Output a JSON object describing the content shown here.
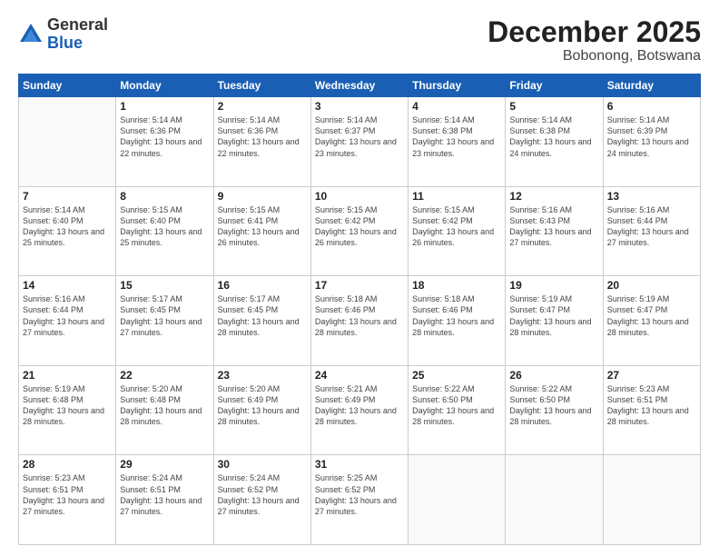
{
  "header": {
    "logo": {
      "general": "General",
      "blue": "Blue"
    },
    "title": "December 2025",
    "subtitle": "Bobonong, Botswana"
  },
  "weekdays": [
    "Sunday",
    "Monday",
    "Tuesday",
    "Wednesday",
    "Thursday",
    "Friday",
    "Saturday"
  ],
  "weeks": [
    [
      {
        "day": "",
        "empty": true
      },
      {
        "day": "1",
        "sunrise": "Sunrise: 5:14 AM",
        "sunset": "Sunset: 6:36 PM",
        "daylight": "Daylight: 13 hours and 22 minutes."
      },
      {
        "day": "2",
        "sunrise": "Sunrise: 5:14 AM",
        "sunset": "Sunset: 6:36 PM",
        "daylight": "Daylight: 13 hours and 22 minutes."
      },
      {
        "day": "3",
        "sunrise": "Sunrise: 5:14 AM",
        "sunset": "Sunset: 6:37 PM",
        "daylight": "Daylight: 13 hours and 23 minutes."
      },
      {
        "day": "4",
        "sunrise": "Sunrise: 5:14 AM",
        "sunset": "Sunset: 6:38 PM",
        "daylight": "Daylight: 13 hours and 23 minutes."
      },
      {
        "day": "5",
        "sunrise": "Sunrise: 5:14 AM",
        "sunset": "Sunset: 6:38 PM",
        "daylight": "Daylight: 13 hours and 24 minutes."
      },
      {
        "day": "6",
        "sunrise": "Sunrise: 5:14 AM",
        "sunset": "Sunset: 6:39 PM",
        "daylight": "Daylight: 13 hours and 24 minutes."
      }
    ],
    [
      {
        "day": "7",
        "sunrise": "Sunrise: 5:14 AM",
        "sunset": "Sunset: 6:40 PM",
        "daylight": "Daylight: 13 hours and 25 minutes."
      },
      {
        "day": "8",
        "sunrise": "Sunrise: 5:15 AM",
        "sunset": "Sunset: 6:40 PM",
        "daylight": "Daylight: 13 hours and 25 minutes."
      },
      {
        "day": "9",
        "sunrise": "Sunrise: 5:15 AM",
        "sunset": "Sunset: 6:41 PM",
        "daylight": "Daylight: 13 hours and 26 minutes."
      },
      {
        "day": "10",
        "sunrise": "Sunrise: 5:15 AM",
        "sunset": "Sunset: 6:42 PM",
        "daylight": "Daylight: 13 hours and 26 minutes."
      },
      {
        "day": "11",
        "sunrise": "Sunrise: 5:15 AM",
        "sunset": "Sunset: 6:42 PM",
        "daylight": "Daylight: 13 hours and 26 minutes."
      },
      {
        "day": "12",
        "sunrise": "Sunrise: 5:16 AM",
        "sunset": "Sunset: 6:43 PM",
        "daylight": "Daylight: 13 hours and 27 minutes."
      },
      {
        "day": "13",
        "sunrise": "Sunrise: 5:16 AM",
        "sunset": "Sunset: 6:44 PM",
        "daylight": "Daylight: 13 hours and 27 minutes."
      }
    ],
    [
      {
        "day": "14",
        "sunrise": "Sunrise: 5:16 AM",
        "sunset": "Sunset: 6:44 PM",
        "daylight": "Daylight: 13 hours and 27 minutes."
      },
      {
        "day": "15",
        "sunrise": "Sunrise: 5:17 AM",
        "sunset": "Sunset: 6:45 PM",
        "daylight": "Daylight: 13 hours and 27 minutes."
      },
      {
        "day": "16",
        "sunrise": "Sunrise: 5:17 AM",
        "sunset": "Sunset: 6:45 PM",
        "daylight": "Daylight: 13 hours and 28 minutes."
      },
      {
        "day": "17",
        "sunrise": "Sunrise: 5:18 AM",
        "sunset": "Sunset: 6:46 PM",
        "daylight": "Daylight: 13 hours and 28 minutes."
      },
      {
        "day": "18",
        "sunrise": "Sunrise: 5:18 AM",
        "sunset": "Sunset: 6:46 PM",
        "daylight": "Daylight: 13 hours and 28 minutes."
      },
      {
        "day": "19",
        "sunrise": "Sunrise: 5:19 AM",
        "sunset": "Sunset: 6:47 PM",
        "daylight": "Daylight: 13 hours and 28 minutes."
      },
      {
        "day": "20",
        "sunrise": "Sunrise: 5:19 AM",
        "sunset": "Sunset: 6:47 PM",
        "daylight": "Daylight: 13 hours and 28 minutes."
      }
    ],
    [
      {
        "day": "21",
        "sunrise": "Sunrise: 5:19 AM",
        "sunset": "Sunset: 6:48 PM",
        "daylight": "Daylight: 13 hours and 28 minutes."
      },
      {
        "day": "22",
        "sunrise": "Sunrise: 5:20 AM",
        "sunset": "Sunset: 6:48 PM",
        "daylight": "Daylight: 13 hours and 28 minutes."
      },
      {
        "day": "23",
        "sunrise": "Sunrise: 5:20 AM",
        "sunset": "Sunset: 6:49 PM",
        "daylight": "Daylight: 13 hours and 28 minutes."
      },
      {
        "day": "24",
        "sunrise": "Sunrise: 5:21 AM",
        "sunset": "Sunset: 6:49 PM",
        "daylight": "Daylight: 13 hours and 28 minutes."
      },
      {
        "day": "25",
        "sunrise": "Sunrise: 5:22 AM",
        "sunset": "Sunset: 6:50 PM",
        "daylight": "Daylight: 13 hours and 28 minutes."
      },
      {
        "day": "26",
        "sunrise": "Sunrise: 5:22 AM",
        "sunset": "Sunset: 6:50 PM",
        "daylight": "Daylight: 13 hours and 28 minutes."
      },
      {
        "day": "27",
        "sunrise": "Sunrise: 5:23 AM",
        "sunset": "Sunset: 6:51 PM",
        "daylight": "Daylight: 13 hours and 28 minutes."
      }
    ],
    [
      {
        "day": "28",
        "sunrise": "Sunrise: 5:23 AM",
        "sunset": "Sunset: 6:51 PM",
        "daylight": "Daylight: 13 hours and 27 minutes."
      },
      {
        "day": "29",
        "sunrise": "Sunrise: 5:24 AM",
        "sunset": "Sunset: 6:51 PM",
        "daylight": "Daylight: 13 hours and 27 minutes."
      },
      {
        "day": "30",
        "sunrise": "Sunrise: 5:24 AM",
        "sunset": "Sunset: 6:52 PM",
        "daylight": "Daylight: 13 hours and 27 minutes."
      },
      {
        "day": "31",
        "sunrise": "Sunrise: 5:25 AM",
        "sunset": "Sunset: 6:52 PM",
        "daylight": "Daylight: 13 hours and 27 minutes."
      },
      {
        "day": "",
        "empty": true
      },
      {
        "day": "",
        "empty": true
      },
      {
        "day": "",
        "empty": true
      }
    ]
  ]
}
